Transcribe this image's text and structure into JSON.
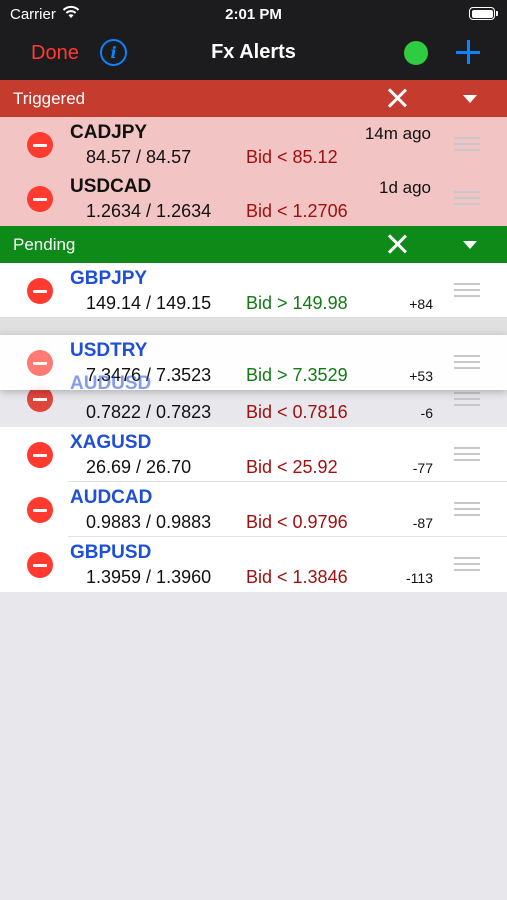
{
  "status_bar": {
    "carrier": "Carrier",
    "time": "2:01 PM"
  },
  "nav": {
    "done_label": "Done",
    "info_glyph": "i",
    "title": "Fx Alerts",
    "connection_color": "#2ecc40"
  },
  "sections": {
    "triggered": {
      "title": "Triggered",
      "color": "#c53b2e",
      "rows": [
        {
          "symbol": "CADJPY",
          "price": "84.57 / 84.57",
          "condition": "Bid < 85.12",
          "age": "14m ago"
        },
        {
          "symbol": "USDCAD",
          "price": "1.2634 / 1.2634",
          "condition": "Bid < 1.2706",
          "age": "1d ago"
        }
      ]
    },
    "pending": {
      "title": "Pending",
      "color": "#0e8a18",
      "rows": [
        {
          "symbol": "GBPJPY",
          "price": "149.14 / 149.15",
          "condition": "Bid > 149.98",
          "diff": "+84"
        },
        {
          "symbol": "AUDUSD",
          "price": "0.7822 / 0.7823",
          "condition": "Bid < 0.7816",
          "diff": "-6"
        },
        {
          "symbol": "XAGUSD",
          "price": "26.69 / 26.70",
          "condition": "Bid < 25.92",
          "diff": "-77"
        },
        {
          "symbol": "AUDCAD",
          "price": "0.9883 / 0.9883",
          "condition": "Bid < 0.9796",
          "diff": "-87"
        },
        {
          "symbol": "GBPUSD",
          "price": "1.3959 / 1.3960",
          "condition": "Bid < 1.3846",
          "diff": "-113"
        }
      ],
      "dragging": {
        "symbol": "USDTRY",
        "price": "7.3476 / 7.3523",
        "condition": "Bid > 7.3529",
        "diff": "+53"
      }
    }
  }
}
